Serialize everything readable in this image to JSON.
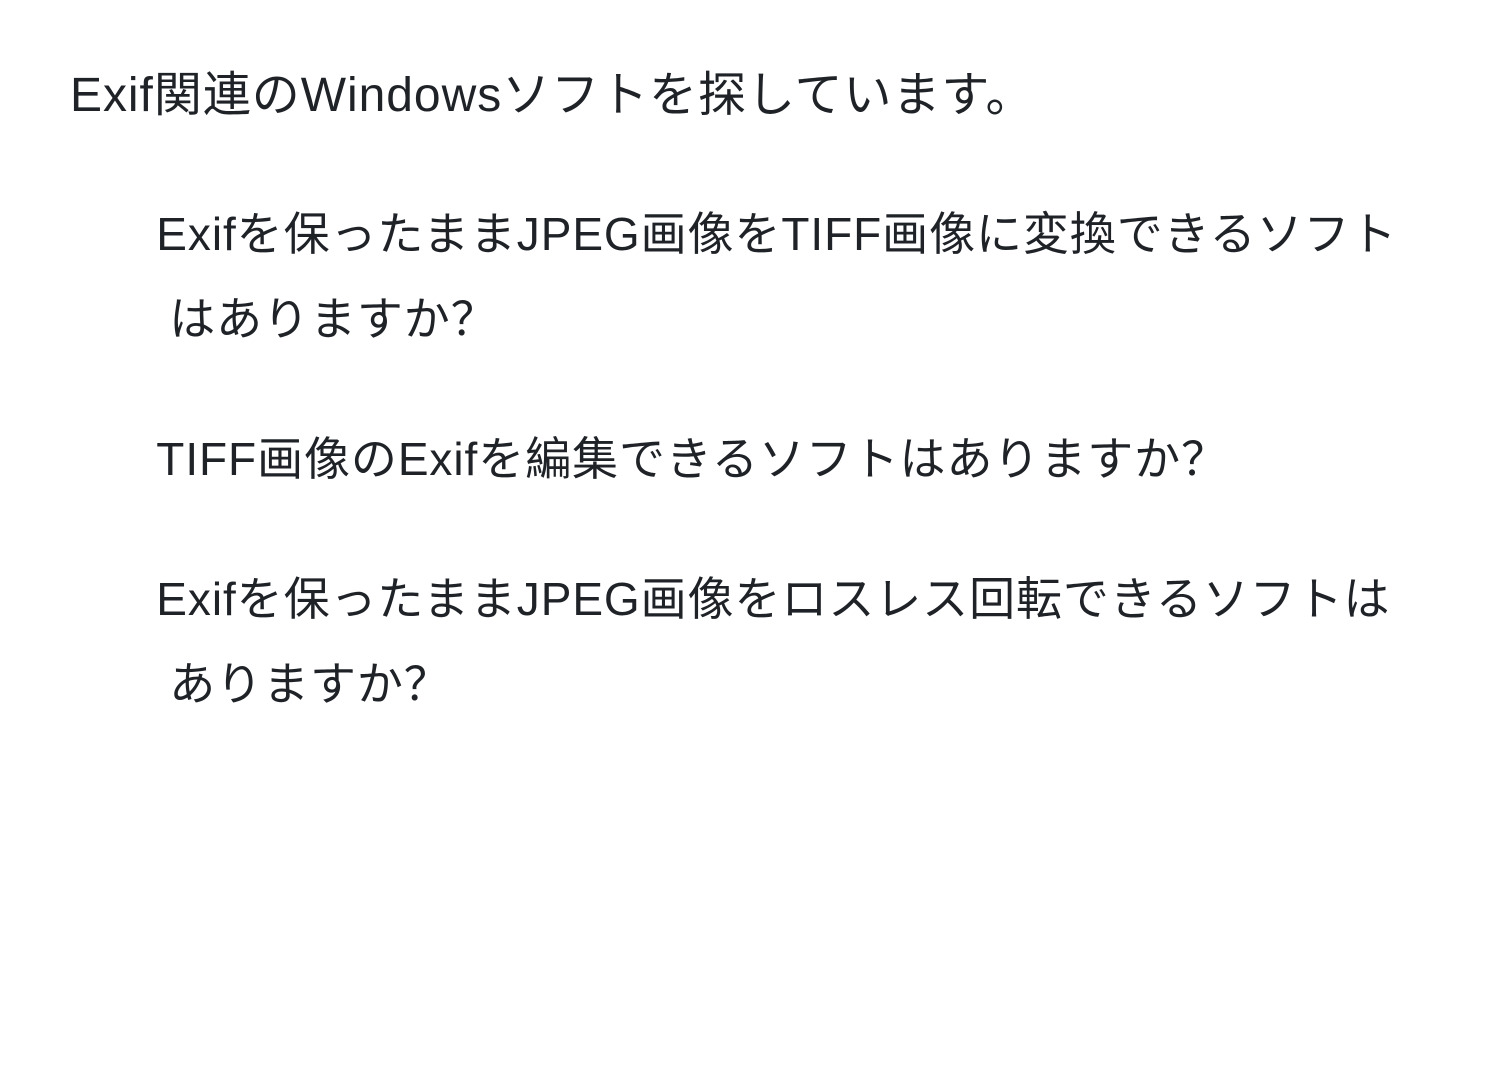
{
  "heading": "Exif関連のWindowsソフトを探しています。",
  "items": [
    "　Exifを保ったままJPEG画像をTIFF画像に変換できるソフトはありますか？",
    "　TIFF画像のExifを編集できるソフトはありますか？",
    "　Exifを保ったままJPEG画像をロスレス回転できるソフトはありますか？"
  ]
}
